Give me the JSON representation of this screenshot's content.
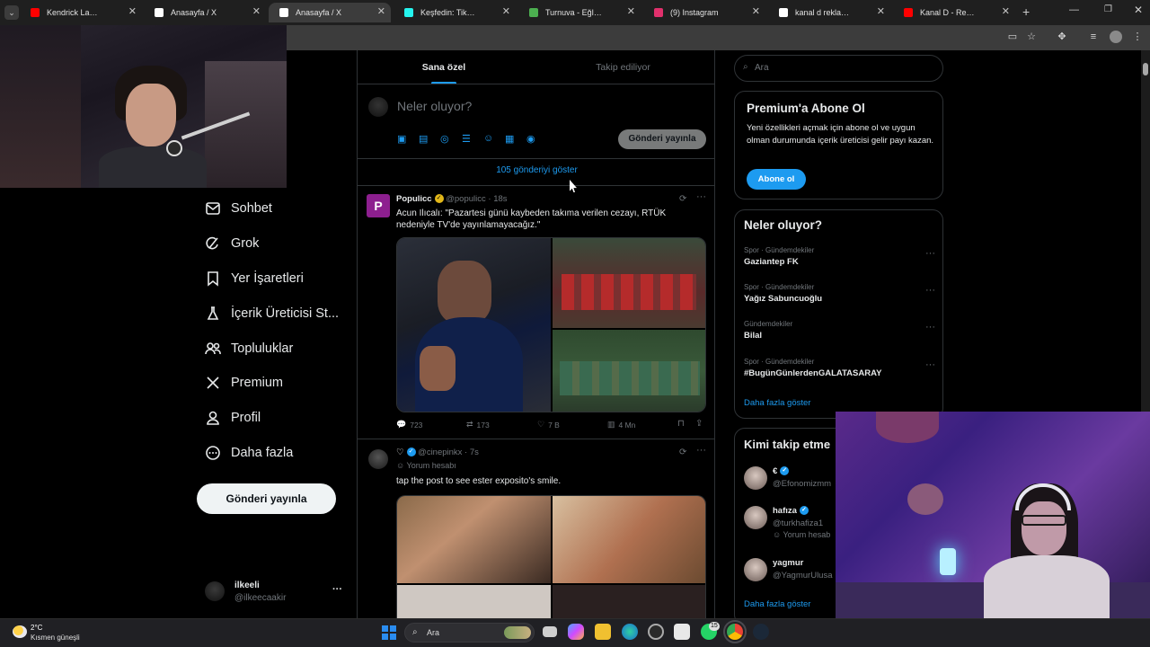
{
  "browser": {
    "tabs": [
      {
        "title": "Kendrick Lamar's Apple M",
        "color": "#ff0000"
      },
      {
        "title": "Anasayfa / X",
        "color": "#ffffff"
      },
      {
        "title": "Anasayfa / X",
        "color": "#ffffff"
      },
      {
        "title": "Keşfedin: TikTok'ta favori",
        "color": "#25f4ee"
      },
      {
        "title": "Turnuva - Eğlenceli seçim",
        "color": "#4caf50"
      },
      {
        "title": "(9) Instagram",
        "color": "#e1306c"
      },
      {
        "title": "kanal d reklam jeneriği - G",
        "color": "#ffffff"
      },
      {
        "title": "Kanal D - Reklam Jeneriği",
        "color": "#ff0000"
      }
    ],
    "new_tab": "+"
  },
  "nav": {
    "items": [
      {
        "label": "Sohbet",
        "icon": "envelope-icon"
      },
      {
        "label": "Grok",
        "icon": "grok-icon"
      },
      {
        "label": "Yer İşaretleri",
        "icon": "bookmark-icon"
      },
      {
        "label": "İçerik Üreticisi St...",
        "icon": "flask-icon"
      },
      {
        "label": "Topluluklar",
        "icon": "people-icon"
      },
      {
        "label": "Premium",
        "icon": "x-logo-icon"
      },
      {
        "label": "Profil",
        "icon": "person-icon"
      },
      {
        "label": "Daha fazla",
        "icon": "more-circle-icon"
      }
    ],
    "post_button": "Gönderi yayınla",
    "account": {
      "name": "ilkeeli",
      "handle": "@ilkeecaakir",
      "more": "···"
    }
  },
  "feed": {
    "tabs": [
      "Sana özel",
      "Takip ediliyor"
    ],
    "composer": {
      "placeholder": "Neler oluyor?",
      "post_button": "Gönderi yayınla"
    },
    "show_more": "105 gönderiyi göster",
    "posts": [
      {
        "name": "Populicc",
        "avatar_letter": "P",
        "handle": "@populicc",
        "time": "18s",
        "text": "Acun Ilıcalı: \"Pazartesi günü kaybeden takıma verilen cezayı, RTÜK nedeniyle TV'de yayınlamayacağız.\"",
        "stats": {
          "replies": "723",
          "reposts": "173",
          "likes": "7 B",
          "views": "4 Mn"
        }
      },
      {
        "name": "♡",
        "handle": "@cinepinkx",
        "time": "7s",
        "reply_label": "Yorum hesabı",
        "text": "tap the post to see ester exposito's smile."
      }
    ]
  },
  "sidebar": {
    "search_placeholder": "Ara",
    "premium": {
      "title": "Premium'a Abone Ol",
      "body": "Yeni özellikleri açmak için abone ol ve uygun olman durumunda içerik üreticisi gelir payı kazan.",
      "button": "Abone ol"
    },
    "trends": {
      "title": "Neler oluyor?",
      "items": [
        {
          "category": "Spor · Gündemdekiler",
          "name": "Gaziantep FK"
        },
        {
          "category": "Spor · Gündemdekiler",
          "name": "Yağız Sabuncuoğlu"
        },
        {
          "category": "Gündemdekiler",
          "name": "Bilal"
        },
        {
          "category": "Spor · Gündemdekiler",
          "name": "#BugünGünlerdenGALATASARAY"
        }
      ],
      "show_more": "Daha fazla göster"
    },
    "follow": {
      "title": "Kimi takip etme",
      "items": [
        {
          "name": "€",
          "handle": "@Efonomizmm",
          "sub": ""
        },
        {
          "name": "hafıza",
          "handle": "@turkhafiza1",
          "sub": "Yorum hesab"
        },
        {
          "name": "yagmur",
          "handle": "@YagmurUlusa",
          "sub": ""
        }
      ],
      "show_more": "Daha fazla göster"
    }
  },
  "taskbar": {
    "weather": {
      "temp": "2°C",
      "desc": "Kısmen güneşli"
    },
    "search": "Ara",
    "badge": "15"
  }
}
